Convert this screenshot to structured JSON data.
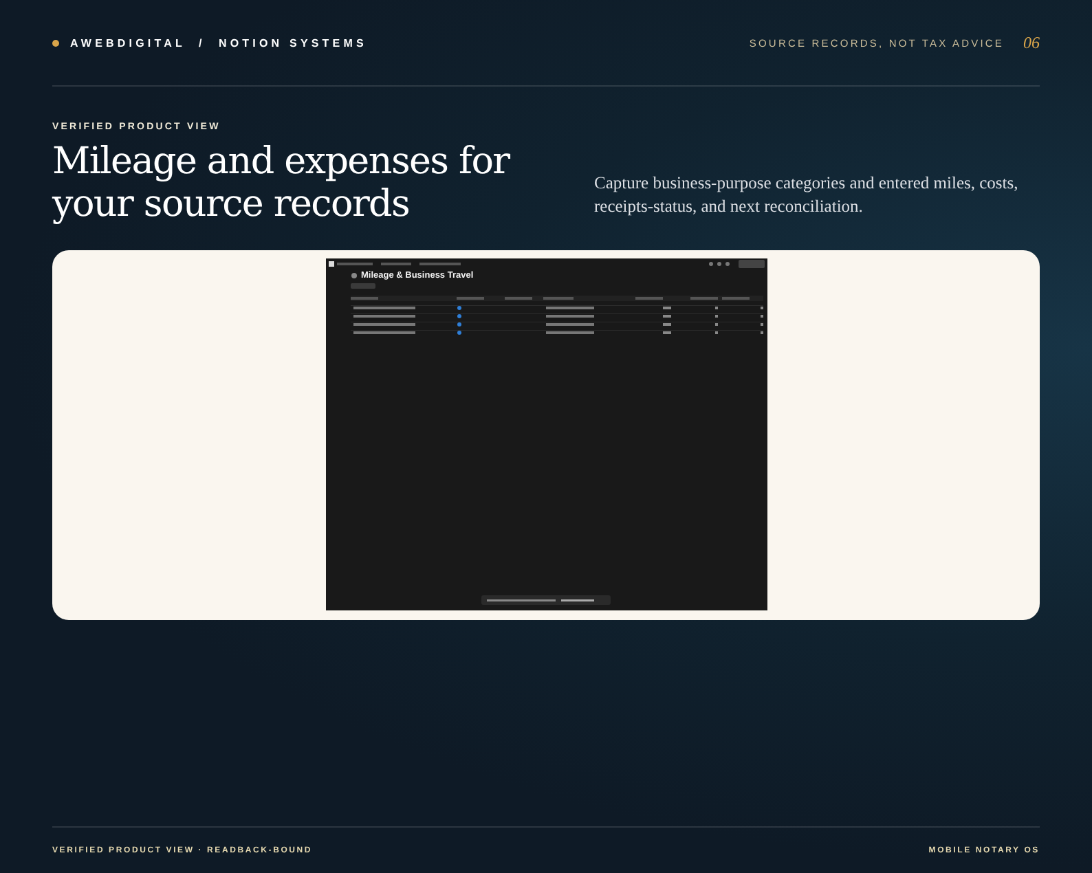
{
  "header": {
    "brand": "AWEBDIGITAL  /  NOTION SYSTEMS",
    "tagline": "SOURCE RECORDS, NOT TAX ADVICE",
    "page_number": "06"
  },
  "hero": {
    "eyebrow": "VERIFIED PRODUCT VIEW",
    "title": "Mileage and expenses for your source records",
    "description": "Capture business-purpose categories and entered miles, costs, receipts-status, and next reconciliation."
  },
  "screenshot": {
    "page_title": "Mileage & Business Travel"
  },
  "footer": {
    "left": "VERIFIED PRODUCT VIEW · READBACK-BOUND",
    "right": "MOBILE NOTARY OS"
  }
}
